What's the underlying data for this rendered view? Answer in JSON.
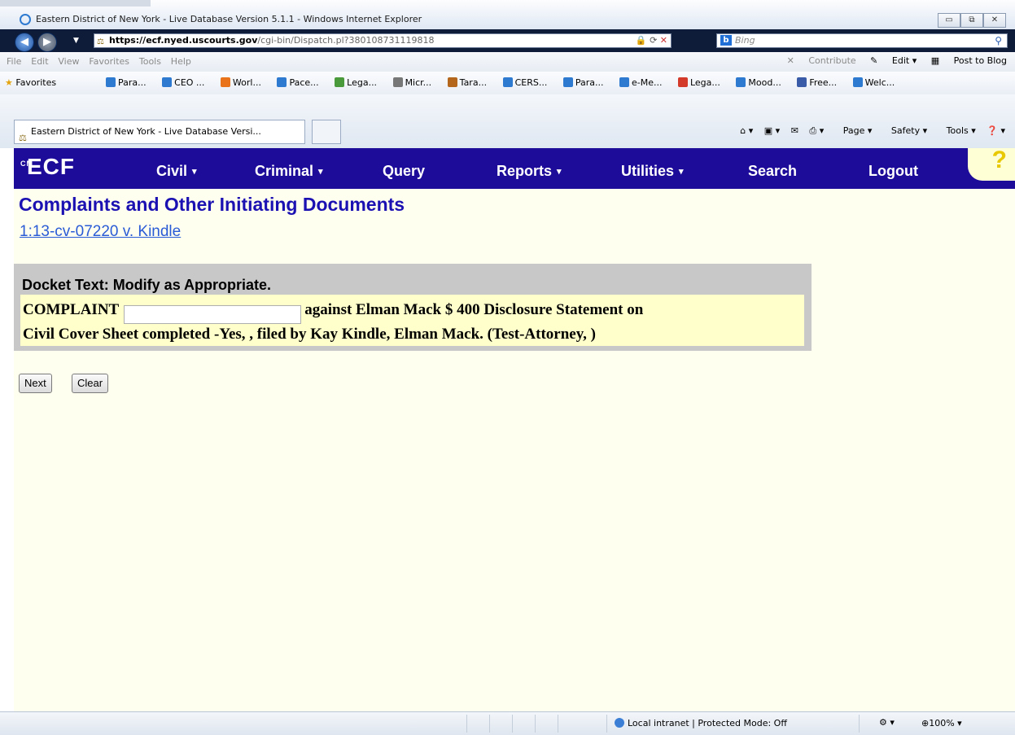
{
  "window": {
    "title": "Eastern District of New York - Live Database Version 5.1.1 - Windows Internet Explorer",
    "minimize": "▭",
    "restore": "⧉",
    "close": "✕"
  },
  "address_bar": {
    "url_host": "https://ecf.nyed.uscourts.gov",
    "url_path": "/cgi-bin/Dispatch.pl?380108731119818",
    "search_placeholder": "Bing"
  },
  "menu": [
    "File",
    "Edit",
    "View",
    "Favorites",
    "Tools",
    "Help"
  ],
  "menu_right": {
    "contribute": "Contribute",
    "edit": "Edit",
    "post_to_blog": "Post to Blog"
  },
  "favorites": {
    "label": "Favorites",
    "links": [
      "Para...",
      "CEO ...",
      "Worl...",
      "Pace...",
      "Lega...",
      "Micr...",
      "Tara...",
      "CERS...",
      "Para...",
      "e-Me...",
      "Lega...",
      "Mood...",
      "Free...",
      "Welc..."
    ]
  },
  "tab": {
    "label": "Eastern District of New York - Live Database Versi..."
  },
  "command_bar": [
    "Page",
    "Safety",
    "Tools"
  ],
  "ecf": {
    "logo": "ECF",
    "nav": {
      "civil": "Civil",
      "criminal": "Criminal",
      "query": "Query",
      "reports": "Reports",
      "utilities": "Utilities",
      "search": "Search",
      "logout": "Logout"
    },
    "help": "?"
  },
  "page": {
    "title": "Complaints and Other Initiating Documents",
    "case_link": "1:13-cv-07220 v. Kindle",
    "docket_label": "Docket Text: Modify as Appropriate.",
    "docket_prefix": "COMPLAINT",
    "docket_input_value": "",
    "docket_line1_rest": "against Elman Mack $ 400 Disclosure Statement on",
    "docket_line2": "Civil Cover Sheet completed -Yes, , filed by Kay Kindle, Elman Mack. (Test-Attorney, )",
    "next_button": "Next",
    "clear_button": "Clear"
  },
  "status": {
    "zone": "Local intranet | Protected Mode: Off",
    "zoom": "100%"
  }
}
